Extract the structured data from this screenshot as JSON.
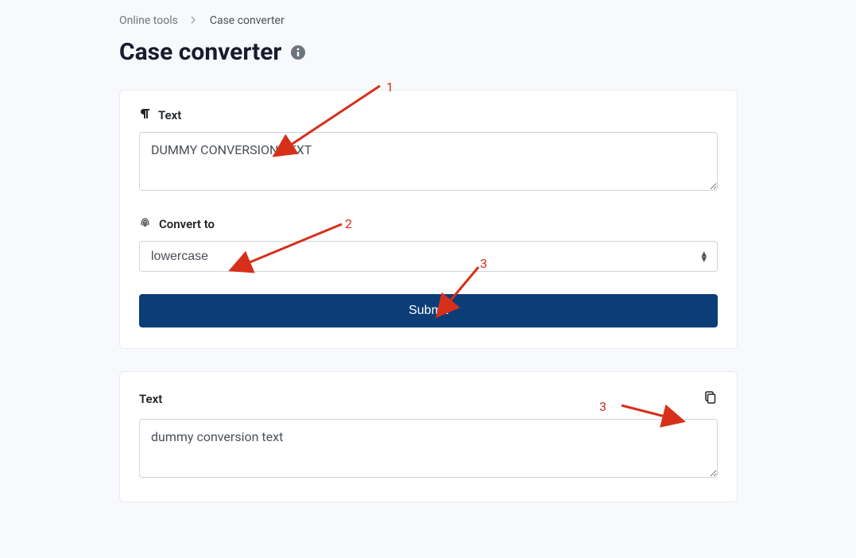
{
  "breadcrumb": {
    "parent": "Online tools",
    "current": "Case converter"
  },
  "page": {
    "title": "Case converter"
  },
  "form": {
    "text_label": "Text",
    "text_value": "DUMMY CONVERSION TEXT",
    "convert_to_label": "Convert to",
    "convert_to_value": "lowercase",
    "submit_label": "Submit"
  },
  "output": {
    "label": "Text",
    "value": "dummy conversion text"
  },
  "annotations": {
    "a1": "1",
    "a2": "2",
    "a3": "3",
    "a4": "3"
  }
}
